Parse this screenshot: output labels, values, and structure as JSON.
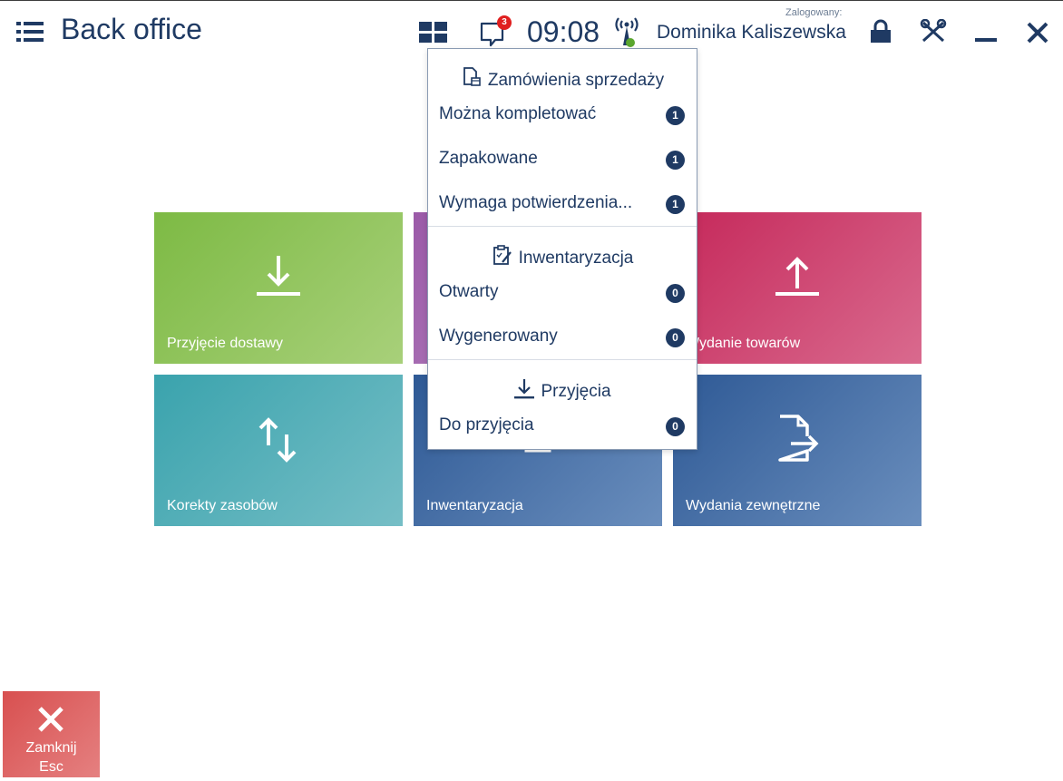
{
  "header": {
    "title": "Back office",
    "notification_count": "3",
    "clock": "09:08",
    "logged_label": "Zalogowany:",
    "user_name": "Dominika Kaliszewska"
  },
  "colors": {
    "primary": "#1f3a63",
    "notification_badge": "#e01f1f",
    "connection_ok": "#5aa62f",
    "tile_green": "#7dba44",
    "tile_purple": "#9b5aa8",
    "tile_red": "#c5285a",
    "tile_teal": "#3aa3ad",
    "tile_blue": "#2e5995",
    "close_tile": "#d85050"
  },
  "tiles": [
    {
      "label": "Przyjęcie dostawy",
      "icon": "download-icon"
    },
    {
      "label": "",
      "icon": ""
    },
    {
      "label": "Wydanie towarów",
      "icon": "upload-icon"
    },
    {
      "label": "Korekty zasobów",
      "icon": "swap-arrows-icon"
    },
    {
      "label": "Inwentaryzacja",
      "icon": "inventory-icon"
    },
    {
      "label": "Wydania zewnętrzne",
      "icon": "document-export-icon"
    }
  ],
  "dropdown": {
    "sections": [
      {
        "title": "Zamówienia sprzedaży",
        "icon": "sales-orders-icon",
        "items": [
          {
            "label": "Można kompletować",
            "count": "1"
          },
          {
            "label": "Zapakowane",
            "count": "1"
          },
          {
            "label": "Wymaga potwierdzenia...",
            "count": "1"
          }
        ]
      },
      {
        "title": "Inwentaryzacja",
        "icon": "clipboard-edit-icon",
        "items": [
          {
            "label": "Otwarty",
            "count": "0"
          },
          {
            "label": "Wygenerowany",
            "count": "0"
          }
        ]
      },
      {
        "title": "Przyjęcia",
        "icon": "download-icon",
        "items": [
          {
            "label": "Do przyjęcia",
            "count": "0"
          }
        ]
      }
    ]
  },
  "close_button": {
    "label_line1": "Zamknij",
    "label_line2": "Esc"
  }
}
